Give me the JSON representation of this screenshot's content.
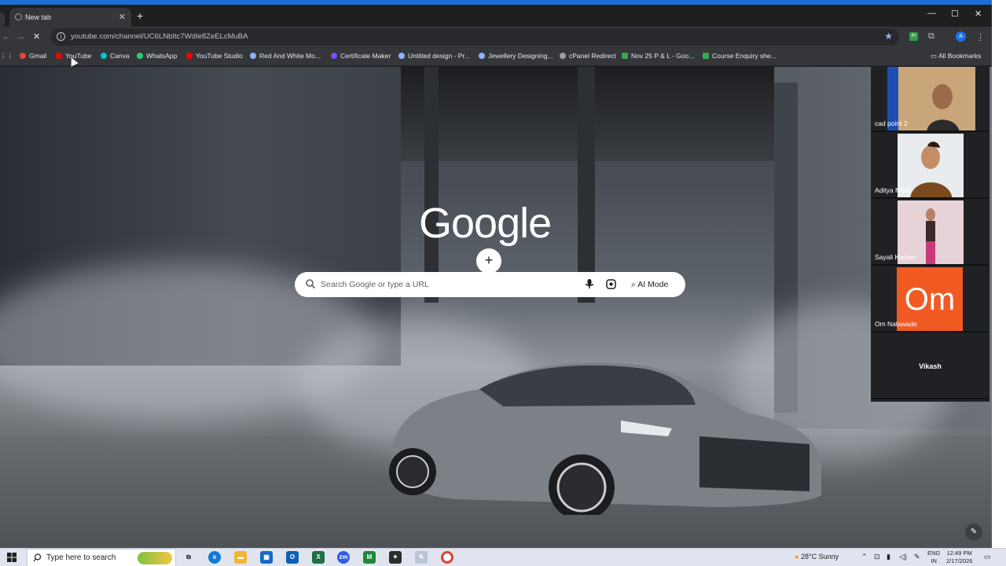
{
  "browser": {
    "tab_title": "New tab",
    "url": "youtube.com/channel/UC6LNbItc7WdIe8ZeELcMuBA",
    "bookmarks": [
      {
        "label": "Gmail",
        "color": "#ea4335"
      },
      {
        "label": "YouTube",
        "color": "#ff0000"
      },
      {
        "label": "Canva",
        "color": "#00c4cc"
      },
      {
        "label": "WhatsApp",
        "color": "#25d366"
      },
      {
        "label": "YouTube Studio",
        "color": "#ff0000"
      },
      {
        "label": "Red And White Mo...",
        "color": "#8ab4f8"
      },
      {
        "label": "Certificate Maker",
        "color": "#7c4dff"
      },
      {
        "label": "Untitled design - Pr...",
        "color": "#8ab4f8"
      },
      {
        "label": "Jewellery Designing...",
        "color": "#8ab4f8"
      },
      {
        "label": "cPanel Redirect",
        "color": "#9aa0a6"
      },
      {
        "label": "Nov 25 P & L - Goo...",
        "color": "#34a853"
      },
      {
        "label": "Course Enquiry she...",
        "color": "#34a853"
      }
    ],
    "all_bookmarks": "All Bookmarks"
  },
  "newtab": {
    "logo": "Google",
    "search_placeholder": "Search Google or type a URL",
    "ai_mode": "AI Mode",
    "add_shortcut": "Add shortcut"
  },
  "meeting": {
    "participants": [
      {
        "name": "cad point 2"
      },
      {
        "name": "Aditya More"
      },
      {
        "name": "Sayali Kadam"
      },
      {
        "name": "Om Nalawade",
        "initials": "Om"
      },
      {
        "name": "Vikash"
      }
    ]
  },
  "taskbar": {
    "search_text": "Type here to search",
    "weather": "28°C  Sunny",
    "lang_top": "ENG",
    "lang_bottom": "IN",
    "time": "12:49 PM",
    "date": "2/17/2026"
  }
}
